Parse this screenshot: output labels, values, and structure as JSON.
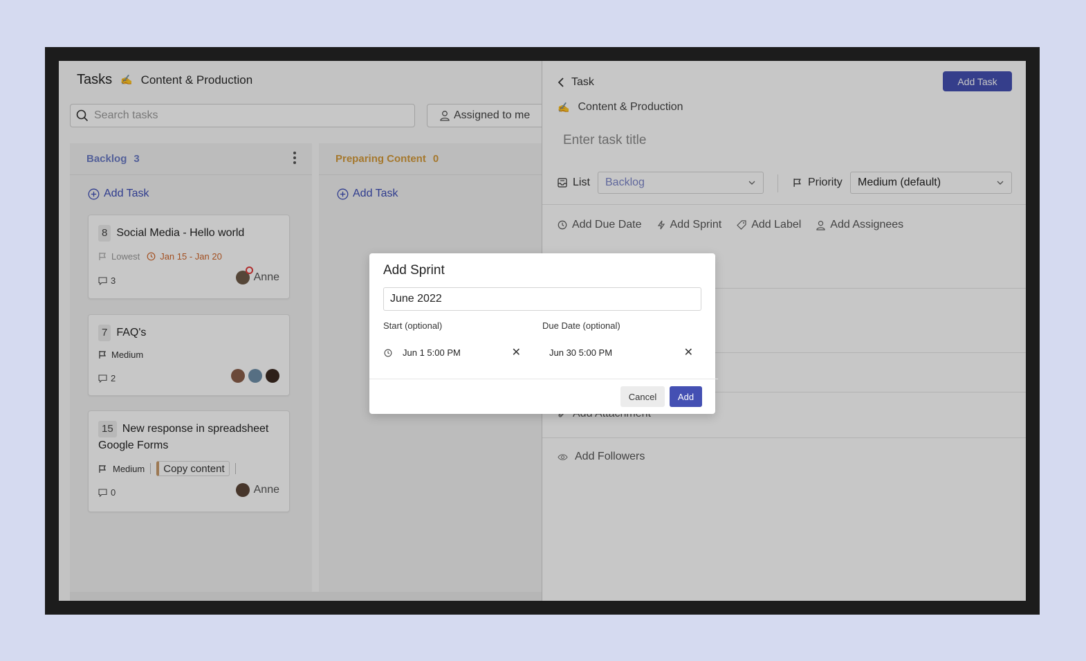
{
  "app": {
    "title": "Tasks",
    "emoji": "✍️",
    "project": "Content & Production"
  },
  "search": {
    "placeholder": "Search tasks",
    "value": ""
  },
  "filter": {
    "assigned_label": "Assigned to me"
  },
  "columns": [
    {
      "name": "Backlog",
      "count": "3",
      "color": "#6b7bc4",
      "add_label": "Add Task",
      "cards": [
        {
          "num": "8",
          "title": "Social Media - Hello world",
          "priority": "Lowest",
          "dates": "Jan 15 - Jan 20",
          "comments": "3",
          "assignee": "Anne"
        },
        {
          "num": "7",
          "title": "FAQ's",
          "priority": "Medium",
          "comments": "2"
        },
        {
          "num": "15",
          "title": "New response in spreadsheet Google Forms",
          "priority": "Medium",
          "label": "Copy content",
          "comments": "0",
          "assignee": "Anne"
        }
      ]
    },
    {
      "name": "Preparing Content",
      "count": "0",
      "color": "#d49a3a",
      "add_label": "Add Task"
    }
  ],
  "panel": {
    "back_label": "Task",
    "add_task_button": "Add Task",
    "project": "Content & Production",
    "title_placeholder": "Enter task title",
    "list_label": "List",
    "list_value": "Backlog",
    "priority_label": "Priority",
    "priority_value": "Medium (default)",
    "actions": [
      "Add Due Date",
      "Add Sprint",
      "Add Label",
      "Add Assignees"
    ],
    "attachment_label": "Add Attachment",
    "followers_label": "Add Followers"
  },
  "dialog": {
    "title": "Add Sprint",
    "name_value": "June 2022",
    "start_label": "Start (optional)",
    "start_value": "Jun 1 5:00 PM",
    "due_label": "Due Date (optional)",
    "due_value": "Jun 30 5:00 PM",
    "cancel_label": "Cancel",
    "add_label": "Add"
  },
  "colors": {
    "accent": "#4450b3",
    "date_warning": "#d0662a",
    "backdrop": "#d5daf0"
  }
}
